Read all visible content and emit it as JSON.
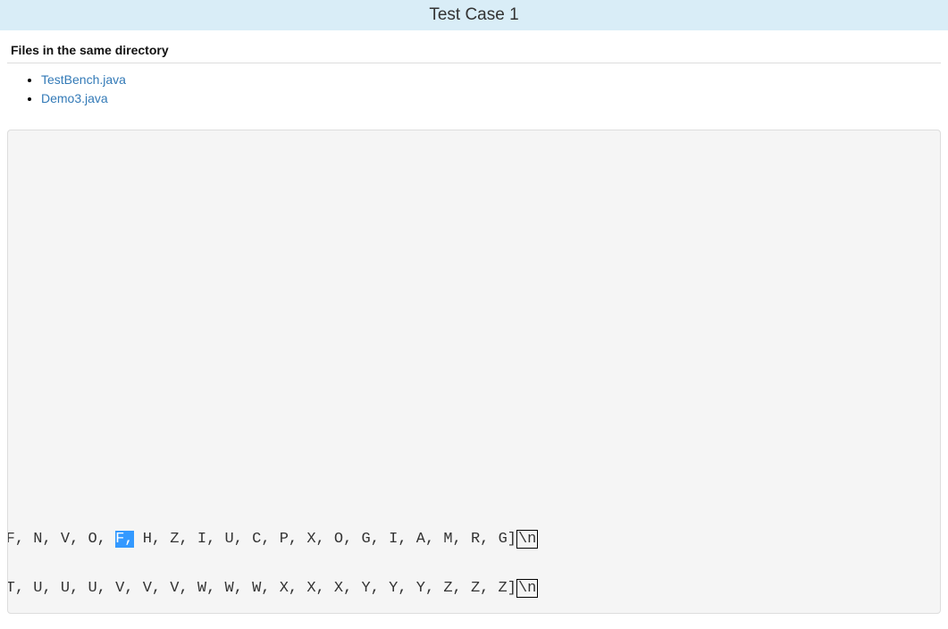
{
  "title": "Test Case 1",
  "files_heading": "Files in the same directory",
  "files": [
    {
      "name": "TestBench.java"
    },
    {
      "name": "Demo3.java"
    }
  ],
  "output": {
    "line1_pre": ", J, A, P, B, X, P, Q, Q, K, F, B, I, F, N, V, O, ",
    "line1_hl": "F,",
    "line1_post": " H, Z, I, U, C, P, X, O, G, I, A, M, R, G]",
    "line2": ", P, Q, Q, Q, R, R, R, S, S, S, T, T, T, U, U, U, V, V, V, W, W, W, X, X, X, Y, Y, Y, Z, Z, Z]",
    "eol": "\\n"
  }
}
